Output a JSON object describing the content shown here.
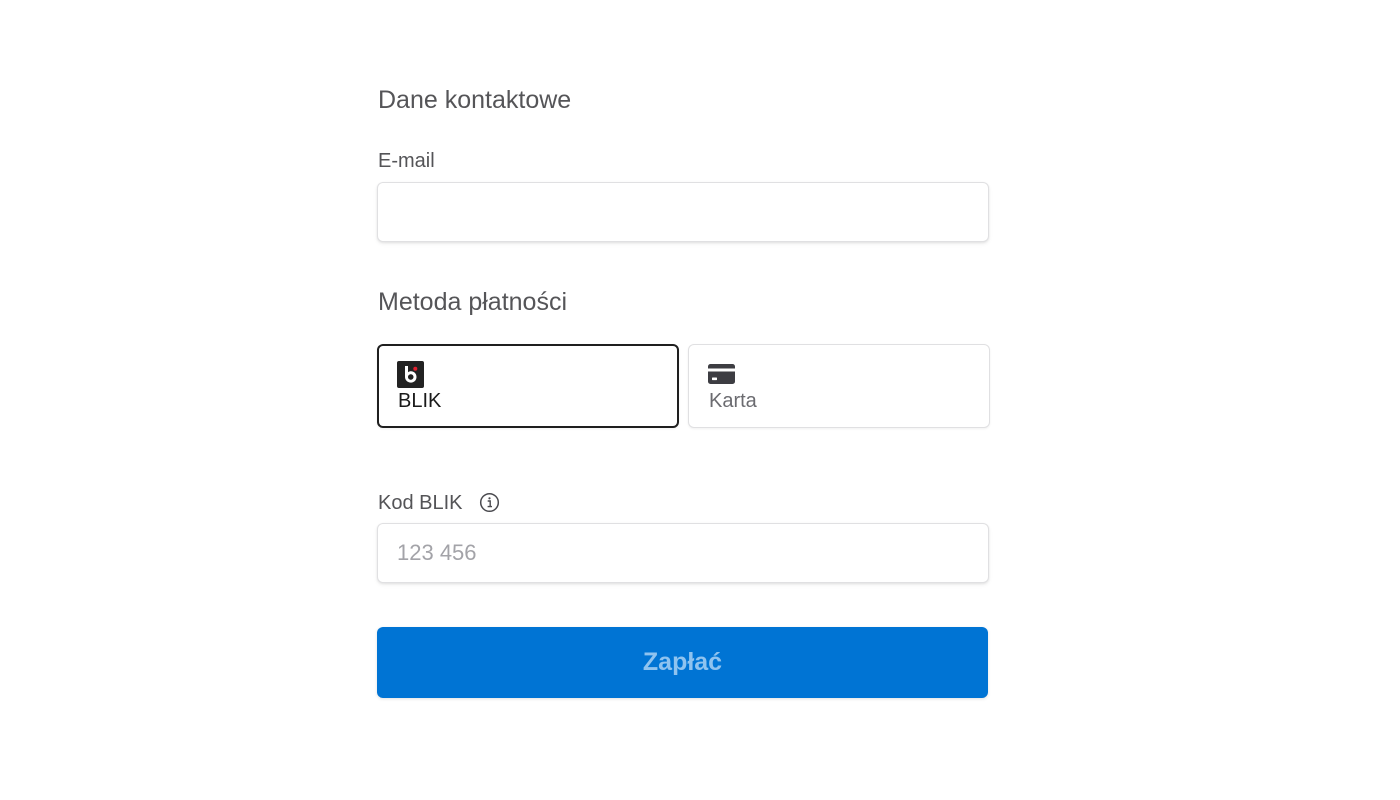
{
  "contact": {
    "title": "Dane kontaktowe",
    "email_label": "E-mail",
    "email_value": "",
    "email_placeholder": ""
  },
  "payment": {
    "title": "Metoda płatności",
    "methods": [
      {
        "label": "BLIK",
        "icon": "blik-logo-icon",
        "selected": true
      },
      {
        "label": "Karta",
        "icon": "credit-card-icon",
        "selected": false
      }
    ],
    "blik_code_label": "Kod BLIK",
    "blik_code_placeholder": "123 456",
    "blik_code_value": ""
  },
  "pay_button": {
    "label": "Zapłać",
    "state": "disabled"
  },
  "colors": {
    "accent": "#0074d4",
    "blik_red": "#e3202f",
    "selected_border": "#1f1f1f"
  }
}
